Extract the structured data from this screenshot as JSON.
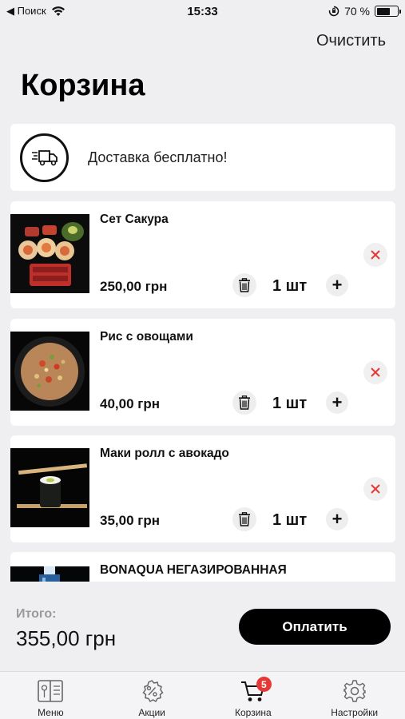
{
  "status_bar": {
    "back_label": "◀ Поиск",
    "time": "15:33",
    "battery": "70 %",
    "battery_level": 0.7
  },
  "header": {
    "clear_label": "Очистить",
    "title": "Корзина"
  },
  "delivery": {
    "text": "Доставка бесплатно!",
    "icon": "delivery-truck-icon"
  },
  "cart_items": [
    {
      "name": "Сет Сакура",
      "price": "250,00 грн",
      "quantity": "1 шт"
    },
    {
      "name": "Рис с овощами",
      "price": "40,00 грн",
      "quantity": "1 шт"
    },
    {
      "name": "Маки ролл с авокадо",
      "price": "35,00 грн",
      "quantity": "1 шт"
    },
    {
      "name": "BONAQUA НЕГАЗИРОВАННАЯ"
    }
  ],
  "total": {
    "label": "Итого:",
    "value": "355,00 грн",
    "pay_label": "Оплатить"
  },
  "tabbar": {
    "tabs": [
      {
        "label": "Меню",
        "icon": "menu-book-icon"
      },
      {
        "label": "Акции",
        "icon": "discount-badge-icon"
      },
      {
        "label": "Корзина",
        "icon": "cart-icon",
        "badge": "5"
      },
      {
        "label": "Настройки",
        "icon": "gear-icon"
      }
    ]
  },
  "colors": {
    "background": "#efeff1",
    "accent": "#000000",
    "badge": "#e53935",
    "remove": "#e53935"
  }
}
